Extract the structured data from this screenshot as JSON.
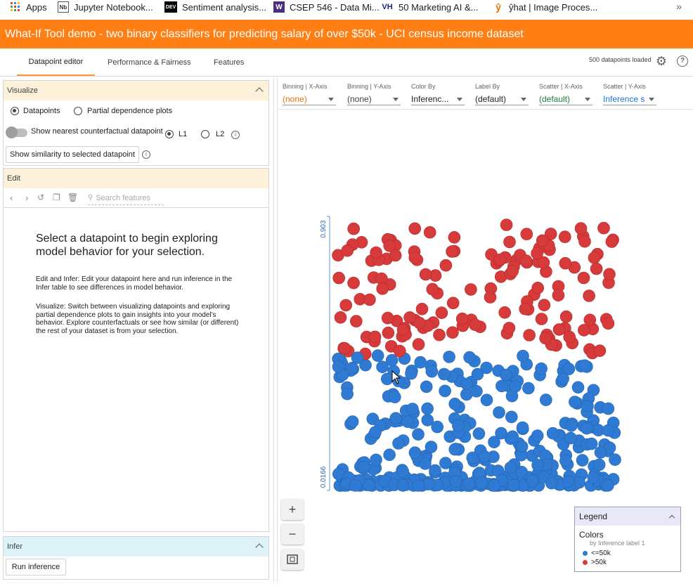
{
  "bookmarks": [
    {
      "label": "Apps",
      "icon": "apps-grid-icon"
    },
    {
      "label": "Jupyter Notebook...",
      "icon": "jupyter-icon"
    },
    {
      "label": "Sentiment analysis...",
      "icon": "dev-icon",
      "icon_text": "DEV"
    },
    {
      "label": "CSEP 546 - Data Mi...",
      "icon": "uw-icon",
      "icon_text": "W"
    },
    {
      "label": "50 Marketing AI &...",
      "icon": "vh-icon",
      "icon_text": "VH"
    },
    {
      "label": "ŷhat | Image Proces...",
      "icon": "yhat-icon",
      "icon_text": "ŷ"
    }
  ],
  "bookmarks_more": "»",
  "title": "What-If Tool demo - two binary classifiers for predicting salary of over $50k - UCI census income dataset",
  "tabs": {
    "datapoint_editor": "Datapoint editor",
    "performance": "Performance & Fairness",
    "features": "Features"
  },
  "status": {
    "datapoints_loaded": "500 datapoints loaded"
  },
  "visualize": {
    "header": "Visualize",
    "datapoints": "Datapoints",
    "pdp": "Partial dependence plots",
    "nearest": "Show nearest counterfactual datapoint",
    "l1": "L1",
    "l2": "L2",
    "similarity": "Show similarity to selected datapoint"
  },
  "edit": {
    "header": "Edit",
    "search_placeholder": "Search features",
    "empty_heading": "Select a datapoint to begin exploring model behavior for your selection.",
    "empty_p1": "Edit and Infer: Edit your datapoint here and run inference in the Infer table to see differences in model behavior.",
    "empty_p2": "Visualize: Switch between visualizing datapoints and exploring partial dependence plots to gain insights into your model's behavior. Explore counterfactuals or see how similar (or different) the rest of your dataset is from your selection."
  },
  "infer": {
    "header": "Infer",
    "run": "Run inference"
  },
  "controls": [
    {
      "label": "Binning | X-Axis",
      "value": "(none)",
      "color": "#e8710a"
    },
    {
      "label": "Binning | Y-Axis",
      "value": "(none)",
      "color": "#3c4043"
    },
    {
      "label": "Color By",
      "value": "Inferenc...",
      "color": "#202124"
    },
    {
      "label": "Label By",
      "value": "(default)",
      "color": "#202124"
    },
    {
      "label": "Scatter | X-Axis",
      "value": "(default)",
      "color": "#188038"
    },
    {
      "label": "Scatter | Y-Axis",
      "value": "Inference s",
      "color": "#1a73e8"
    }
  ],
  "plot": {
    "y_top": "0.903",
    "y_bottom": "0.0166"
  },
  "zoom": {
    "in": "+",
    "out": "−"
  },
  "legend": {
    "header": "Legend",
    "colors": "Colors",
    "by": "by Inference label 1",
    "items": [
      {
        "label": "<=50k",
        "color": "#2f7bd4"
      },
      {
        "label": ">50k",
        "color": "#d73a3a"
      }
    ]
  },
  "chart_data": {
    "type": "scatter",
    "color_by": "Inference label 1",
    "ylim": [
      0.0166,
      0.903
    ],
    "series": [
      {
        "name": "<=50k",
        "color": "#2f7bd4"
      },
      {
        "name": ">50k",
        "color": "#d73a3a"
      }
    ]
  }
}
